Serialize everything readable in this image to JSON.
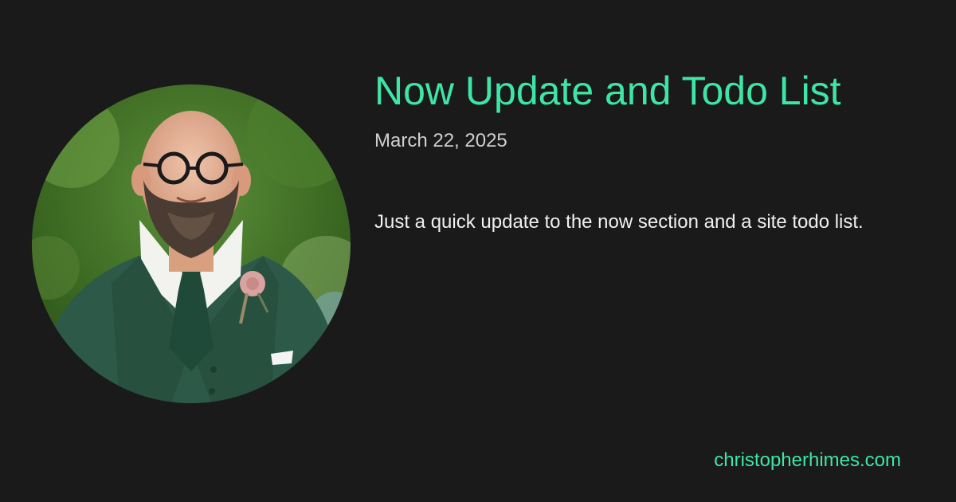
{
  "post": {
    "title": "Now Update and Todo List",
    "date": "March 22, 2025",
    "description": "Just a quick update to the now section and a site todo list."
  },
  "site": {
    "domain": "christopherhimes.com"
  },
  "avatar": {
    "icon": "author-photo-icon"
  },
  "colors": {
    "background": "#1a1a1a",
    "accent": "#3ee6a6",
    "date_text": "#cfcfcf",
    "body_text": "#f0f0f0"
  }
}
